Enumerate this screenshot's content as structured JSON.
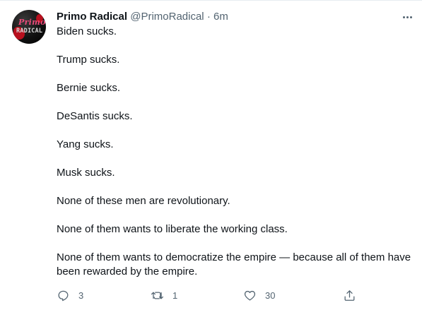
{
  "tweet": {
    "author": {
      "name": "Primo Radical",
      "handle": "@PrimoRadical",
      "avatar_logo_top": "Primo",
      "avatar_logo_bottom": "RADICAL"
    },
    "separator": "·",
    "time": "6m",
    "paragraphs": [
      "Biden sucks.",
      "Trump sucks.",
      "Bernie sucks.",
      "DeSantis sucks.",
      "Yang sucks.",
      "Musk sucks.",
      "None of these men are revolutionary.",
      "None of them wants to liberate the working class.",
      "None of them wants to democratize the empire — because all of them have been rewarded by the empire."
    ],
    "actions": {
      "reply": {
        "icon": "reply-icon",
        "count": "3"
      },
      "retweet": {
        "icon": "retweet-icon",
        "count": "1"
      },
      "like": {
        "icon": "heart-icon",
        "count": "30"
      },
      "share": {
        "icon": "share-icon"
      }
    }
  },
  "colors": {
    "text": "#0f1419",
    "secondary": "#536471",
    "avatar_red": "#b8101e",
    "avatar_pink": "#e94b7a"
  }
}
